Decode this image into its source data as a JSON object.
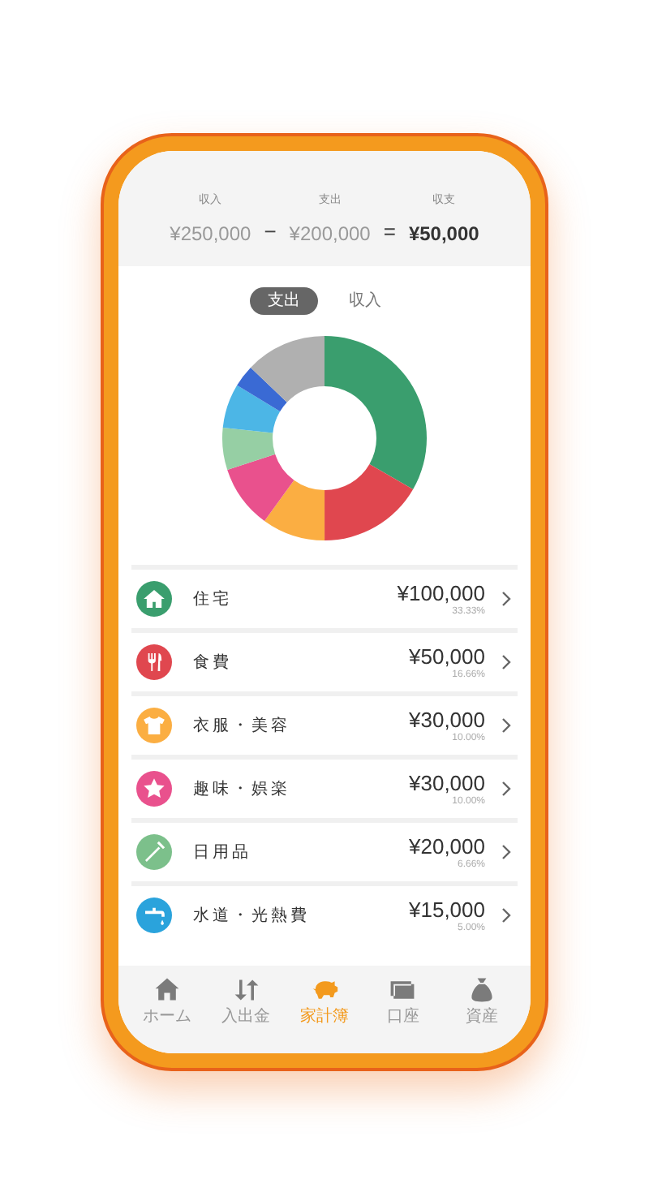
{
  "summary": {
    "items": [
      {
        "label": "収入",
        "amount": "¥250,000",
        "emphasis": false
      },
      {
        "label": "支出",
        "amount": "¥200,000",
        "emphasis": false
      },
      {
        "label": "収支",
        "amount": "¥50,000",
        "emphasis": true
      }
    ],
    "operators": [
      "−",
      "="
    ]
  },
  "toggle": [
    {
      "label": "支出",
      "selected": true
    },
    {
      "label": "収入",
      "selected": false
    }
  ],
  "categories": [
    {
      "kind": "house",
      "name": "住宅",
      "amount": "¥100,000",
      "percent": "33.33%",
      "color": "#3a9e6e"
    },
    {
      "kind": "cutlery",
      "name": "食費",
      "amount": "¥50,000",
      "percent": "16.66%",
      "color": "#e0474f"
    },
    {
      "kind": "shirt",
      "name": "衣服・美容",
      "amount": "¥30,000",
      "percent": "10.00%",
      "color": "#fbae42"
    },
    {
      "kind": "star",
      "name": "趣味・娯楽",
      "amount": "¥30,000",
      "percent": "10.00%",
      "color": "#e9518d"
    },
    {
      "kind": "brush",
      "name": "日用品",
      "amount": "¥20,000",
      "percent": "6.66%",
      "color": "#7cc08b"
    },
    {
      "kind": "faucet",
      "name": "水道・光熱費",
      "amount": "¥15,000",
      "percent": "5.00%",
      "color": "#2aa3dc"
    }
  ],
  "tab_bar": [
    {
      "kind": "house",
      "label": "ホーム",
      "selected": false
    },
    {
      "kind": "arrows",
      "label": "入出金",
      "selected": false
    },
    {
      "kind": "piggy",
      "label": "家計簿",
      "selected": true
    },
    {
      "kind": "card",
      "label": "口座",
      "selected": false
    },
    {
      "kind": "bag",
      "label": "資産",
      "selected": false
    }
  ]
}
